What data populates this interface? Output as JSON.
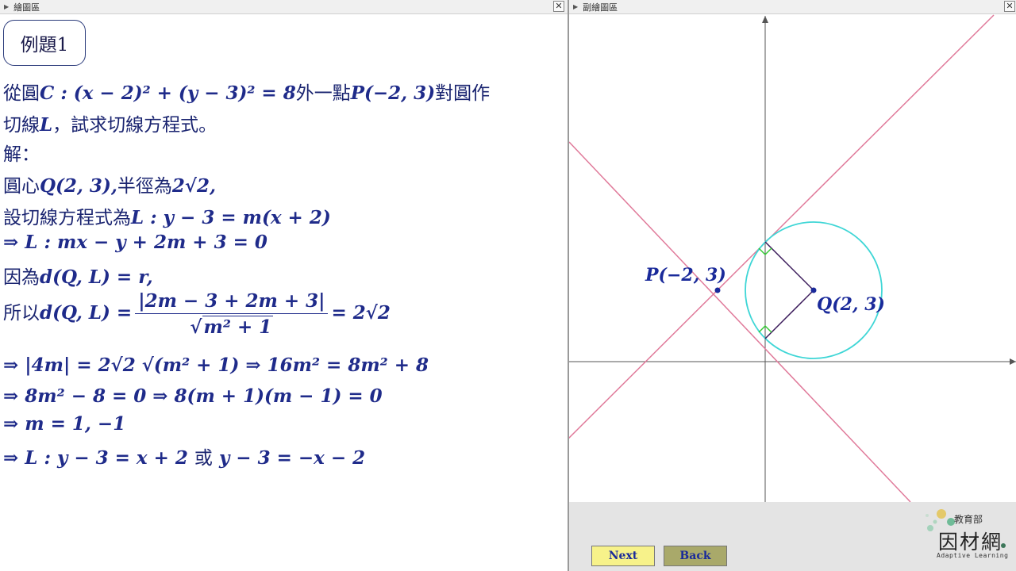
{
  "left_panel": {
    "title": "繪圖區"
  },
  "right_panel": {
    "title": "副繪圖區"
  },
  "close_glyph": "✕",
  "example_title": "例題1",
  "lines": {
    "q1a": "從圓",
    "q1b": "C : (x − 2)² + (y − 3)² = 8",
    "q1c": "外一點",
    "q1d": "P(−2, 3)",
    "q1e": "對圓作",
    "q2a": "切線",
    "q2b": "L",
    "q2c": "，試求切線方程式。",
    "sol": "解：",
    "s1a": "圓心",
    "s1b": "Q(2, 3),",
    "s1c": "半徑為",
    "s1d": "2√2,",
    "s2a": "設切線方程式為",
    "s2b": "L : y − 3 = m(x + 2)",
    "s3": "⇒ L : mx − y + 2m + 3 = 0",
    "s4a": "因為",
    "s4b": "d(Q, L) = r,",
    "s5a": "所以",
    "s5b": "d(Q, L) =",
    "s5num": "|2m − 3 + 2m + 3|",
    "s5den": "m² + 1",
    "s5c": "= 2√2",
    "s6": "⇒ |4m| = 2√2 √(m² + 1) ⇒ 16m² = 8m² + 8",
    "s7": "⇒ 8m² − 8 = 0 ⇒ 8(m + 1)(m − 1) = 0",
    "s8": "⇒ m = 1, −1",
    "s9a": "⇒ L : y − 3 = x + 2",
    "s9b": "或",
    "s9c": "y − 3 = −x − 2"
  },
  "graph": {
    "label_P": "P(−2, 3)",
    "label_Q": "Q(2, 3)",
    "colors": {
      "circle": "#3fd6d6",
      "tangent": "#e07a9a",
      "radius": "#3a1a5a",
      "right_angle": "#33cc33",
      "axis": "#555555",
      "label": "#1a2a9a"
    }
  },
  "buttons": {
    "next": "Next",
    "back": "Back"
  },
  "logo": {
    "org": "教育部",
    "name": "因材網",
    "tagline": "Adaptive Learning"
  }
}
